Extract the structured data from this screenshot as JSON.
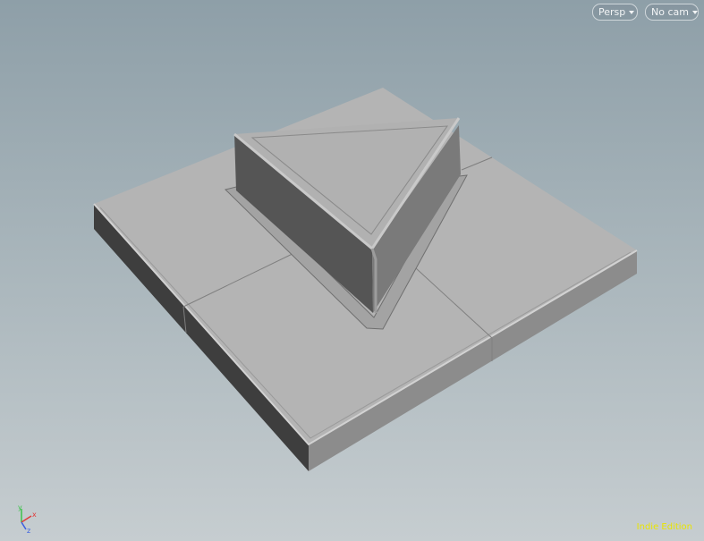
{
  "viewport": {
    "view_menu_label": "Persp",
    "camera_menu_label": "No cam",
    "edition_label": "Indie Edition",
    "axis": {
      "x_label": "x",
      "y_label": "y",
      "z_label": "z",
      "x_color": "#e03a3a",
      "y_color": "#3cc24a",
      "z_color": "#3a5fe0"
    },
    "icons": {
      "view_menu": "chevron-down-icon",
      "camera_menu": "chevron-down-icon"
    }
  }
}
